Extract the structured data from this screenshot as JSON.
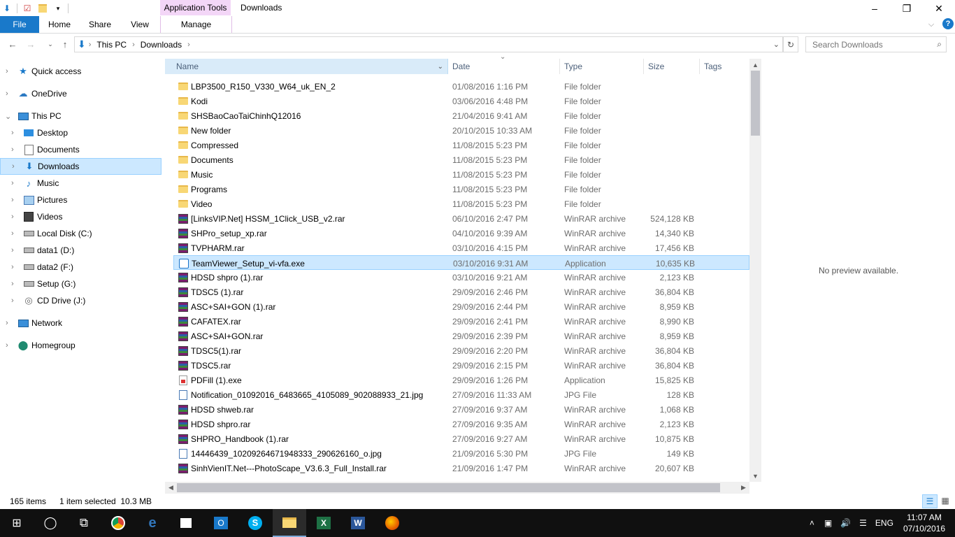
{
  "window": {
    "title": "Downloads",
    "contextual_tab_group": "Application Tools",
    "controls": {
      "minimize": "–",
      "maximize": "❐",
      "close": "✕"
    }
  },
  "ribbon": {
    "tabs": [
      {
        "label": "File"
      },
      {
        "label": "Home"
      },
      {
        "label": "Share"
      },
      {
        "label": "View"
      },
      {
        "label": "Manage"
      }
    ],
    "collapse_glyph": "⌵",
    "help_glyph": "?"
  },
  "address": {
    "breadcrumb": [
      "This PC",
      "Downloads"
    ],
    "separator": "›",
    "search_placeholder": "Search Downloads"
  },
  "nav_pane": {
    "items": [
      {
        "label": "Quick access",
        "icon": "star-icon"
      },
      {
        "label": "OneDrive",
        "icon": "cloud-icon"
      },
      {
        "label": "This PC",
        "icon": "computer-icon"
      },
      {
        "label": "Desktop",
        "icon": "desktop-icon"
      },
      {
        "label": "Documents",
        "icon": "documents-icon"
      },
      {
        "label": "Downloads",
        "icon": "downloads-icon"
      },
      {
        "label": "Music",
        "icon": "music-icon"
      },
      {
        "label": "Pictures",
        "icon": "pictures-icon"
      },
      {
        "label": "Videos",
        "icon": "videos-icon"
      },
      {
        "label": "Local Disk (C:)",
        "icon": "drive-icon"
      },
      {
        "label": "data1 (D:)",
        "icon": "drive-icon"
      },
      {
        "label": "data2 (F:)",
        "icon": "drive-icon"
      },
      {
        "label": "Setup (G:)",
        "icon": "drive-icon"
      },
      {
        "label": "CD Drive (J:)",
        "icon": "cd-drive-icon"
      },
      {
        "label": "Network",
        "icon": "network-icon"
      },
      {
        "label": "Homegroup",
        "icon": "homegroup-icon"
      }
    ]
  },
  "columns": {
    "name": "Name",
    "date": "Date",
    "type": "Type",
    "size": "Size",
    "tags": "Tags"
  },
  "files": [
    {
      "name": "LBP3500_R150_V330_W64_uk_EN_2",
      "date": "01/08/2016 1:16 PM",
      "type": "File folder",
      "size": "",
      "icon": "folder"
    },
    {
      "name": "Kodi",
      "date": "03/06/2016 4:48 PM",
      "type": "File folder",
      "size": "",
      "icon": "folder"
    },
    {
      "name": "SHSBaoCaoTaiChinhQ12016",
      "date": "21/04/2016 9:41 AM",
      "type": "File folder",
      "size": "",
      "icon": "folder"
    },
    {
      "name": "New folder",
      "date": "20/10/2015 10:33 AM",
      "type": "File folder",
      "size": "",
      "icon": "folder"
    },
    {
      "name": "Compressed",
      "date": "11/08/2015 5:23 PM",
      "type": "File folder",
      "size": "",
      "icon": "folder"
    },
    {
      "name": "Documents",
      "date": "11/08/2015 5:23 PM",
      "type": "File folder",
      "size": "",
      "icon": "folder"
    },
    {
      "name": "Music",
      "date": "11/08/2015 5:23 PM",
      "type": "File folder",
      "size": "",
      "icon": "folder"
    },
    {
      "name": "Programs",
      "date": "11/08/2015 5:23 PM",
      "type": "File folder",
      "size": "",
      "icon": "folder"
    },
    {
      "name": "Video",
      "date": "11/08/2015 5:23 PM",
      "type": "File folder",
      "size": "",
      "icon": "folder"
    },
    {
      "name": "[LinksVIP.Net] HSSM_1Click_USB_v2.rar",
      "date": "06/10/2016 2:47 PM",
      "type": "WinRAR archive",
      "size": "524,128 KB",
      "icon": "rar"
    },
    {
      "name": "SHPro_setup_xp.rar",
      "date": "04/10/2016 9:39 AM",
      "type": "WinRAR archive",
      "size": "14,340 KB",
      "icon": "rar"
    },
    {
      "name": "TVPHARM.rar",
      "date": "03/10/2016 4:15 PM",
      "type": "WinRAR archive",
      "size": "17,456 KB",
      "icon": "rar"
    },
    {
      "name": "TeamViewer_Setup_vi-vfa.exe",
      "date": "03/10/2016 9:31 AM",
      "type": "Application",
      "size": "10,635 KB",
      "icon": "exe",
      "selected": true
    },
    {
      "name": "HDSD shpro (1).rar",
      "date": "03/10/2016 9:21 AM",
      "type": "WinRAR archive",
      "size": "2,123 KB",
      "icon": "rar"
    },
    {
      "name": "TDSC5 (1).rar",
      "date": "29/09/2016 2:46 PM",
      "type": "WinRAR archive",
      "size": "36,804 KB",
      "icon": "rar"
    },
    {
      "name": "ASC+SAI+GON (1).rar",
      "date": "29/09/2016 2:44 PM",
      "type": "WinRAR archive",
      "size": "8,959 KB",
      "icon": "rar"
    },
    {
      "name": "CAFATEX.rar",
      "date": "29/09/2016 2:41 PM",
      "type": "WinRAR archive",
      "size": "8,990 KB",
      "icon": "rar"
    },
    {
      "name": "ASC+SAI+GON.rar",
      "date": "29/09/2016 2:39 PM",
      "type": "WinRAR archive",
      "size": "8,959 KB",
      "icon": "rar"
    },
    {
      "name": "TDSC5(1).rar",
      "date": "29/09/2016 2:20 PM",
      "type": "WinRAR archive",
      "size": "36,804 KB",
      "icon": "rar"
    },
    {
      "name": "TDSC5.rar",
      "date": "29/09/2016 2:15 PM",
      "type": "WinRAR archive",
      "size": "36,804 KB",
      "icon": "rar"
    },
    {
      "name": "PDFill (1).exe",
      "date": "29/09/2016 1:26 PM",
      "type": "Application",
      "size": "15,825 KB",
      "icon": "pdf"
    },
    {
      "name": "Notification_01092016_6483665_4105089_902088933_21.jpg",
      "date": "27/09/2016 11:33 AM",
      "type": "JPG File",
      "size": "128 KB",
      "icon": "jpg"
    },
    {
      "name": "HDSD shweb.rar",
      "date": "27/09/2016 9:37 AM",
      "type": "WinRAR archive",
      "size": "1,068 KB",
      "icon": "rar"
    },
    {
      "name": "HDSD shpro.rar",
      "date": "27/09/2016 9:35 AM",
      "type": "WinRAR archive",
      "size": "2,123 KB",
      "icon": "rar"
    },
    {
      "name": "SHPRO_Handbook (1).rar",
      "date": "27/09/2016 9:27 AM",
      "type": "WinRAR archive",
      "size": "10,875 KB",
      "icon": "rar"
    },
    {
      "name": "14446439_10209264671948333_290626160_o.jpg",
      "date": "21/09/2016 5:30 PM",
      "type": "JPG File",
      "size": "149 KB",
      "icon": "jpg"
    },
    {
      "name": "SinhVienIT.Net---PhotoScape_V3.6.3_Full_Install.rar",
      "date": "21/09/2016 1:47 PM",
      "type": "WinRAR archive",
      "size": "20,607 KB",
      "icon": "rar"
    }
  ],
  "preview": {
    "text": "No preview available."
  },
  "status": {
    "items": "165 items",
    "selected": "1 item selected  10.3 MB"
  },
  "taskbar": {
    "apps": [
      "start-icon",
      "cortana-icon",
      "task-view-icon",
      "chrome-icon",
      "edge-icon",
      "store-icon",
      "outlook-icon",
      "skype-icon",
      "file-explorer-icon",
      "excel-icon",
      "word-icon",
      "firefox-icon"
    ],
    "tray": {
      "language": "ENG",
      "time": "11:07 AM",
      "date": "07/10/2016"
    }
  }
}
